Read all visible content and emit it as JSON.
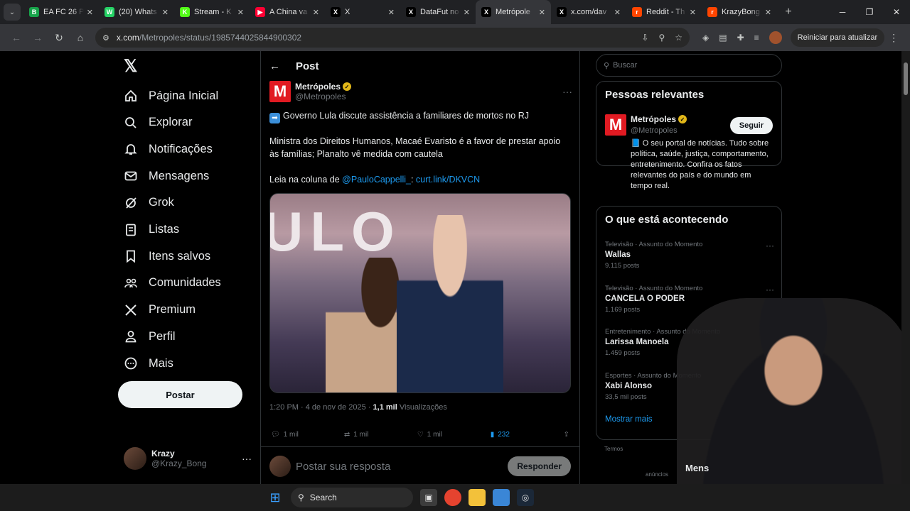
{
  "browser": {
    "tabs": [
      {
        "title": "EA FC 26 P",
        "favicon_color": "#17a34a",
        "favicon_glyph": "B"
      },
      {
        "title": "(20) Whats",
        "favicon_color": "#25d366",
        "favicon_glyph": "W"
      },
      {
        "title": "Stream - K",
        "favicon_color": "#53fc18",
        "favicon_glyph": "K"
      },
      {
        "title": "A China va",
        "favicon_color": "#ff0033",
        "favicon_glyph": "▶"
      },
      {
        "title": "X",
        "favicon_color": "#000000",
        "favicon_glyph": "X"
      },
      {
        "title": "DataFut no",
        "favicon_color": "#000000",
        "favicon_glyph": "X"
      },
      {
        "title": "Metrópole",
        "favicon_color": "#000000",
        "favicon_glyph": "X",
        "active": true
      },
      {
        "title": "x.com/dav",
        "favicon_color": "#000000",
        "favicon_glyph": "X"
      },
      {
        "title": "Reddit - Th",
        "favicon_color": "#ff4500",
        "favicon_glyph": "r"
      },
      {
        "title": "KrazyBong",
        "favicon_color": "#ff4500",
        "favicon_glyph": "r"
      }
    ],
    "url_host": "x.com",
    "url_path": "/Metropoles/status/1985744025844900302",
    "restart_label": "Reiniciar para atualizar"
  },
  "nav": {
    "items": [
      {
        "label": "Página Inicial",
        "icon": "home-icon"
      },
      {
        "label": "Explorar",
        "icon": "search-icon"
      },
      {
        "label": "Notificações",
        "icon": "bell-icon"
      },
      {
        "label": "Mensagens",
        "icon": "mail-icon"
      },
      {
        "label": "Grok",
        "icon": "grok-icon"
      },
      {
        "label": "Listas",
        "icon": "list-icon"
      },
      {
        "label": "Itens salvos",
        "icon": "bookmark-icon"
      },
      {
        "label": "Comunidades",
        "icon": "communities-icon"
      },
      {
        "label": "Premium",
        "icon": "x-icon"
      },
      {
        "label": "Perfil",
        "icon": "person-icon"
      },
      {
        "label": "Mais",
        "icon": "more-circle-icon"
      }
    ],
    "post_button": "Postar",
    "account": {
      "name": "Krazy",
      "handle": "@Krazy_Bong"
    }
  },
  "post": {
    "header": "Post",
    "author_name": "Metrópoles",
    "author_handle": "@Metropoles",
    "headline": "Governo Lula discute assistência a familiares de mortos no RJ",
    "body": "Ministra dos Direitos Humanos, Macaé Evaristo é a favor de prestar apoio às famílias; Planalto vê medida com cautela",
    "read_prefix": "Leia na coluna de ",
    "mention": "@PauloCappelli_",
    "colon": ": ",
    "link": "curt.link/DKVCN",
    "image_text": "ULO",
    "timestamp": "1:20 PM · 4 de nov de 2025 · ",
    "views_count": "1,1 mil",
    "views_label": " Visualizações",
    "replies": "1 mil",
    "reposts": "1 mil",
    "likes": "1 mil",
    "bookmarks": "232",
    "reply_placeholder": "Postar sua resposta",
    "reply_button": "Responder"
  },
  "sidebar": {
    "search_placeholder": "Buscar",
    "relevant_title": "Pessoas relevantes",
    "relevant": {
      "name": "Metrópoles",
      "handle": "@Metropoles",
      "follow_label": "Seguir",
      "bio": "📘 O seu portal de notícias. Tudo sobre política, saúde, justiça, comportamento, entretenimento. Confira os fatos relevantes do país e do mundo em tempo real."
    },
    "trends_title": "O que está acontecendo",
    "trends": [
      {
        "category": "Televisão · Assunto do Momento",
        "title": "Wallas",
        "count": "9.115 posts"
      },
      {
        "category": "Televisão · Assunto do Momento",
        "title": "CANCELA O PODER",
        "count": "1.169 posts"
      },
      {
        "category": "Entretenimento · Assunto do Momento",
        "title": "Larissa Manoela",
        "count": "1.459 posts"
      },
      {
        "category": "Esportes · Assunto do Momento",
        "title": "Xabi Alonso",
        "count": "33,5 mil posts"
      }
    ],
    "show_more": "Mostrar mais",
    "terms": "Termos",
    "ads_fragment": "anúncios"
  },
  "overlay": {
    "partial_text": "Mens"
  },
  "taskbar": {
    "search_label": "Search"
  },
  "colors": {
    "accent": "#1d9bf0",
    "metropoles_red": "#e11a22",
    "verified_gold": "#e2b719"
  }
}
